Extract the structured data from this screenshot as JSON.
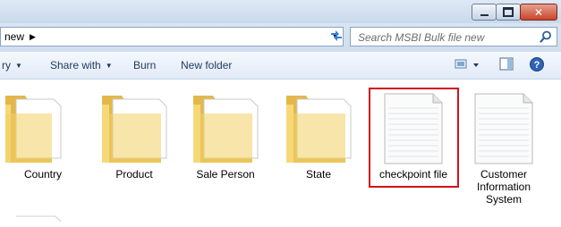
{
  "window": {
    "minimize_icon": "minimize-icon",
    "maximize_icon": "maximize-icon",
    "close_icon": "close-icon"
  },
  "address": {
    "crumb": "new",
    "crumb_arrow": "▶"
  },
  "search": {
    "placeholder": "Search MSBI Bulk file new"
  },
  "toolbar": {
    "organize_partial": "ry",
    "share_with": "Share with",
    "burn": "Burn",
    "new_folder": "New folder",
    "caret": "▼"
  },
  "items": [
    {
      "label": "Country",
      "type": "folder"
    },
    {
      "label": "Product",
      "type": "folder"
    },
    {
      "label": "Sale Person",
      "type": "folder"
    },
    {
      "label": "State",
      "type": "folder"
    },
    {
      "label": "checkpoint file",
      "type": "file",
      "selected": true
    },
    {
      "label": "Customer\nInformation\nSystem",
      "type": "file"
    }
  ],
  "colors": {
    "selection_border": "#d2131a",
    "folder": "#f1cf6b",
    "toolbar_text": "#1e395b"
  }
}
